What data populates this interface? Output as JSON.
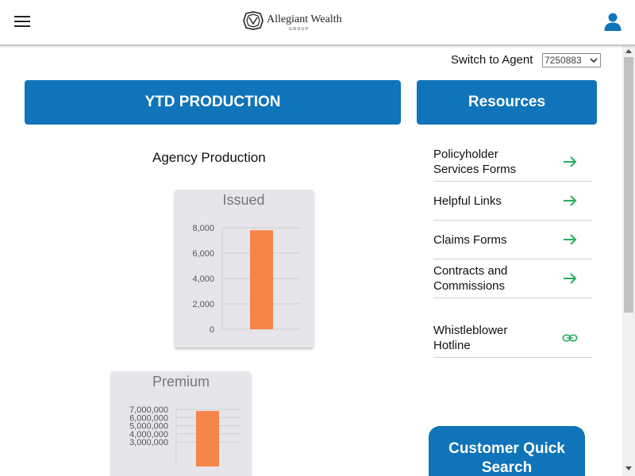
{
  "header": {
    "logo_text": "Allegiant Wealth",
    "logo_sub": "GROUP",
    "menu_icon": "hamburger-menu-icon",
    "user_icon": "user-account-icon"
  },
  "agent_switch": {
    "label": "Switch to Agent",
    "selected_value": "7250883"
  },
  "main": {
    "ytd_label": "YTD PRODUCTION",
    "agency_title": "Agency Production"
  },
  "resources": {
    "header_label": "Resources",
    "items": [
      {
        "label": "  Policyholder\nServices Forms",
        "icon": "arrow-right-icon"
      },
      {
        "label": "  Helpful Links",
        "icon": "arrow-right-icon"
      },
      {
        "label": "  Claims Forms",
        "icon": "arrow-right-icon"
      },
      {
        "label": "  Contracts and\nCommissions",
        "icon": "arrow-right-icon"
      },
      {
        "label": "  Whistleblower\nHotline",
        "icon": "link-icon"
      }
    ]
  },
  "quick_search": {
    "label": "Customer Quick Search"
  },
  "colors": {
    "brand_blue": "#0f74b9",
    "bar_orange": "#f6854a",
    "icon_green": "#27ae60"
  },
  "chart_data": [
    {
      "type": "bar",
      "title": "Issued",
      "categories": [
        ""
      ],
      "values": [
        7800
      ],
      "ylim": [
        0,
        8000
      ],
      "yticks": [
        0,
        2000,
        4000,
        6000,
        8000
      ],
      "ytick_labels": [
        "0",
        "2,000",
        "4,000",
        "6,000",
        "8,000"
      ],
      "grid": true
    },
    {
      "type": "bar",
      "title": "Premium",
      "categories": [
        ""
      ],
      "values": [
        6800000
      ],
      "ylim": [
        0,
        7000000
      ],
      "yticks": [
        3000000,
        4000000,
        5000000,
        6000000,
        7000000
      ],
      "ytick_labels": [
        "3,000,000",
        "4,000,000",
        "5,000,000",
        "6,000,000",
        "7,000,000"
      ],
      "grid": true
    }
  ]
}
